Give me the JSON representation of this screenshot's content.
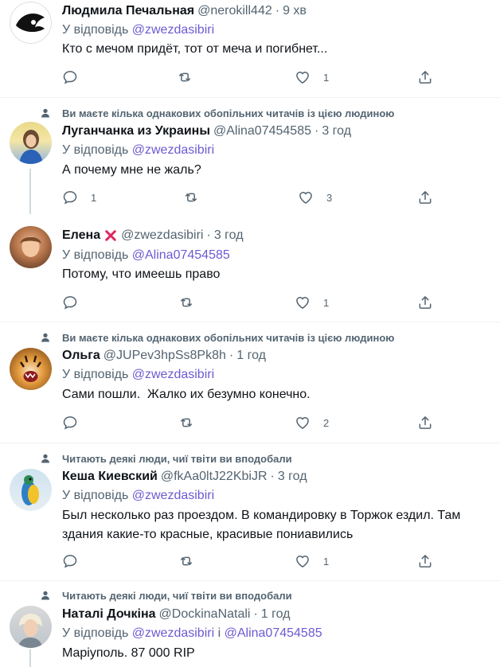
{
  "colors": {
    "mention": "#6b5bd2",
    "secondary": "#536471",
    "divider": "#eff3f4",
    "red_x": "#e0245e"
  },
  "reply_prefix": "У відповідь",
  "tweets": [
    {
      "social": "",
      "name": "Людмила Печальная",
      "handle": "@nerokill442",
      "dot": "·",
      "time": "9 хв",
      "reply_to": "@zwezdasibiri",
      "reply_to2": "",
      "text": "Кто с мечом придёт, тот от меча и погибнет...",
      "replies": "",
      "retweets": "",
      "likes": "1"
    },
    {
      "social": "Ви маєте кілька однакових обопільних читачів із цією людиною",
      "name": "Луганчанка из Украины",
      "handle": "@Alina07454585",
      "dot": "·",
      "time": "3 год",
      "reply_to": "@zwezdasibiri",
      "reply_to2": "",
      "text": "А почему мне не жаль?",
      "replies": "1",
      "retweets": "",
      "likes": "3"
    },
    {
      "social": "",
      "name": "Елена",
      "handle": "@zwezdasibiri",
      "dot": "·",
      "time": "3 год",
      "reply_to": "@Alina07454585",
      "reply_to2": "",
      "text": "Потому, что имеешь право",
      "replies": "",
      "retweets": "",
      "likes": "1"
    },
    {
      "social": "Ви маєте кілька однакових обопільних читачів із цією людиною",
      "name": "Ольга",
      "handle": "@JUPev3hpSs8Pk8h",
      "dot": "·",
      "time": "1 год",
      "reply_to": "@zwezdasibiri",
      "reply_to2": "",
      "text": "Сами пошли.  Жалко их безумно конечно.",
      "replies": "",
      "retweets": "",
      "likes": "2"
    },
    {
      "social": "Читають деякі люди, чиї твіти ви вподобали",
      "name": "Кеша Киевский",
      "handle": "@fkAa0ltJ22KbiJR",
      "dot": "·",
      "time": "3 год",
      "reply_to": "@zwezdasibiri",
      "reply_to2": "",
      "text": "Был несколько раз проездом. В командировку в Торжок ездил. Там здания какие-то красные, красивые пониавились",
      "replies": "",
      "retweets": "",
      "likes": "1"
    },
    {
      "social": "Читають деякі люди, чиї твіти ви вподобали",
      "name": "Наталі Дочкіна",
      "handle": "@DockinaNatali",
      "dot": "·",
      "time": "1 год",
      "reply_to": "@zwezdasibiri",
      "reply_conj": "і",
      "reply_to2": "@Alina07454585",
      "text": "Маріуполь. 87 000 RIP",
      "replies": "",
      "retweets": "",
      "likes": ""
    }
  ]
}
